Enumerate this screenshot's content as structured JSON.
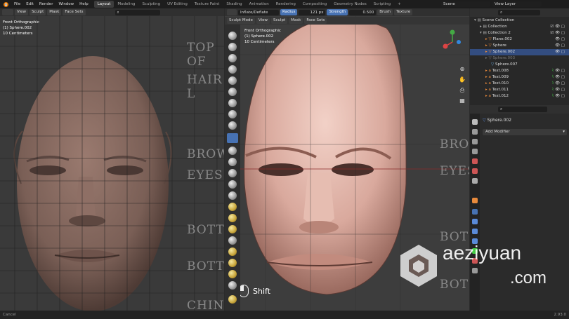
{
  "topbar": {
    "menus": [
      "File",
      "Edit",
      "Render",
      "Window",
      "Help"
    ],
    "workspaces": [
      "Layout",
      "Modeling",
      "Sculpting",
      "UV Editing",
      "Texture Paint",
      "Shading",
      "Animation",
      "Rendering",
      "Compositing",
      "Geometry Nodes",
      "Scripting"
    ],
    "active_workspace": "Layout",
    "add_tab": "+",
    "scene_label": "Scene",
    "view_layer_label": "View Layer"
  },
  "left_view": {
    "header_buttons": [
      "Sculpt",
      "Mask",
      "Face Sets"
    ],
    "view_label": "View",
    "projection": "Front Orthographic",
    "object": "(1) Sphere.002",
    "scale": "10 Centimeters",
    "reference_labels": [
      "TOP OF",
      "HAIR L",
      "BROW",
      "EYES",
      "BOTT",
      "BOTT",
      "CHIN"
    ]
  },
  "right_view": {
    "mode_label": "Sculpt Mode",
    "header_buttons": [
      "View",
      "Sculpt",
      "Mask",
      "Face Sets"
    ],
    "brush_name": "Inflate/Deflate",
    "radius_label": "Radius",
    "radius_value": "121 px",
    "strength_label": "Strength",
    "strength_value": "0.500",
    "brush_menu": "Brush",
    "texture_menu": "Texture",
    "projection": "Front Orthographic",
    "object": "(1) Sphere.002",
    "scale": "10 Centimeters",
    "reference_labels": [
      "BRO",
      "EYES",
      "BOT",
      "BOT"
    ],
    "shift_hint": "Shift"
  },
  "outliner": {
    "rows": [
      {
        "label": "Scene Collection",
        "type": "collection",
        "indent": 0
      },
      {
        "label": "Collection",
        "type": "collection",
        "indent": 1
      },
      {
        "label": "Collection 2",
        "type": "collection",
        "indent": 1
      },
      {
        "label": "Plane.002",
        "type": "mesh",
        "indent": 2
      },
      {
        "label": "Sphere",
        "type": "mesh",
        "indent": 2
      },
      {
        "label": "Sphere.002",
        "type": "mesh",
        "indent": 2,
        "selected": true
      },
      {
        "label": "Sphere.003",
        "type": "mesh",
        "indent": 2,
        "dim": true
      },
      {
        "label": "Sphere.007",
        "type": "mesh",
        "indent": 3
      },
      {
        "label": "Text.008",
        "type": "text",
        "indent": 2
      },
      {
        "label": "Text.009",
        "type": "text",
        "indent": 2
      },
      {
        "label": "Text.010",
        "type": "text",
        "indent": 2
      },
      {
        "label": "Text.011",
        "type": "text",
        "indent": 2
      },
      {
        "label": "Text.012",
        "type": "text",
        "indent": 2
      }
    ]
  },
  "properties": {
    "object_name": "Sphere.002",
    "add_modifier": "Add Modifier"
  },
  "status": {
    "left": "Cancel",
    "right": "2.93.0"
  },
  "watermark": {
    "line1": "aeziyuan",
    "line2": ".com"
  },
  "colors": {
    "accent": "#4772b3",
    "selected_row": "#334d80",
    "face_left": "#8a6c62",
    "face_right": "#d7a79c"
  }
}
